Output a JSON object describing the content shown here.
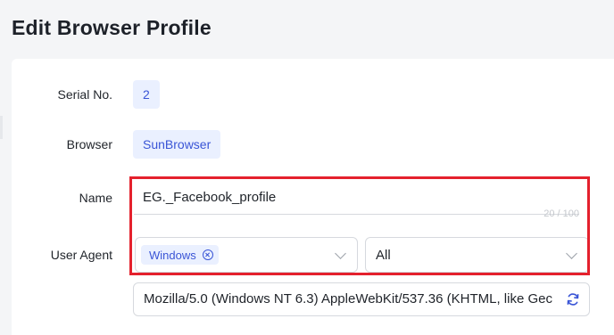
{
  "page": {
    "title": "Edit Browser Profile"
  },
  "form": {
    "serial": {
      "label": "Serial No.",
      "value": "2"
    },
    "browser": {
      "label": "Browser",
      "value": "SunBrowser"
    },
    "name": {
      "label": "Name",
      "value": "EG._Facebook_profile",
      "counter": "20 / 100"
    },
    "user_agent": {
      "label": "User Agent",
      "os_selected_chip": "Windows",
      "filter_selected": "All",
      "value": "Mozilla/5.0 (Windows NT 6.3) AppleWebKit/537.36 (KHTML, like Gec"
    }
  },
  "colors": {
    "accent": "#3a55d6",
    "tag_background": "#eaf0ff",
    "highlight": "#e4212d",
    "page_background": "#f4f5f7"
  },
  "icons": {
    "chip_remove": "close-circle-icon",
    "select_arrow": "chevron-down-icon",
    "refresh": "refresh-icon"
  }
}
